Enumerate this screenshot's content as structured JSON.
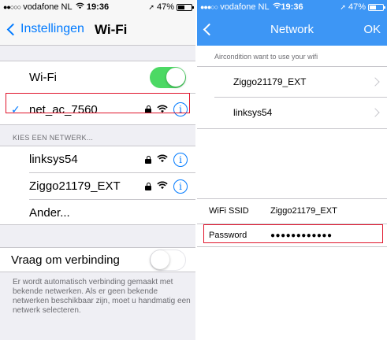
{
  "left": {
    "status": {
      "signal": "●●○○○",
      "carrier": "vodafone NL",
      "time": "19:36",
      "battery": "47%",
      "battery_level": 0.47
    },
    "nav": {
      "back_label": "Instellingen",
      "title": "Wi-Fi"
    },
    "wifi_row": {
      "label": "Wi-Fi",
      "toggle_on": true
    },
    "connected": {
      "check": "✓",
      "name": "net_ac_7560",
      "info": "i"
    },
    "section_header": "KIES EEN NETWERK...",
    "networks": [
      {
        "name": "linksys54",
        "info": "i"
      },
      {
        "name": "Ziggo21179_EXT",
        "info": "i"
      },
      {
        "name": "Ander..."
      }
    ],
    "ask_row": {
      "label": "Vraag om verbinding",
      "toggle_on": false
    },
    "footer": "Er wordt automatisch verbinding gemaakt met bekende netwerken. Als er geen bekende netwerken beschikbaar zijn, moet u handmatig een netwerk selecteren."
  },
  "right": {
    "status": {
      "signal": "●●●○○",
      "carrier": "vodafone NL",
      "time": "19:36",
      "battery": "47%",
      "battery_level": 0.47
    },
    "nav": {
      "title": "Network",
      "ok": "OK"
    },
    "hint": "Aircondition want to use your wifi",
    "networks": [
      {
        "name": "Ziggo21179_EXT"
      },
      {
        "name": "linksys54"
      }
    ],
    "ssid": {
      "label": "WiFi SSID",
      "value": "Ziggo21179_EXT"
    },
    "password": {
      "label": "Password",
      "value": "●●●●●●●●●●●●"
    }
  },
  "colors": {
    "ios_blue": "#007aff",
    "toggle_green": "#4cd964",
    "header_blue": "#3d96f5",
    "highlight_red": "#e0142b"
  }
}
